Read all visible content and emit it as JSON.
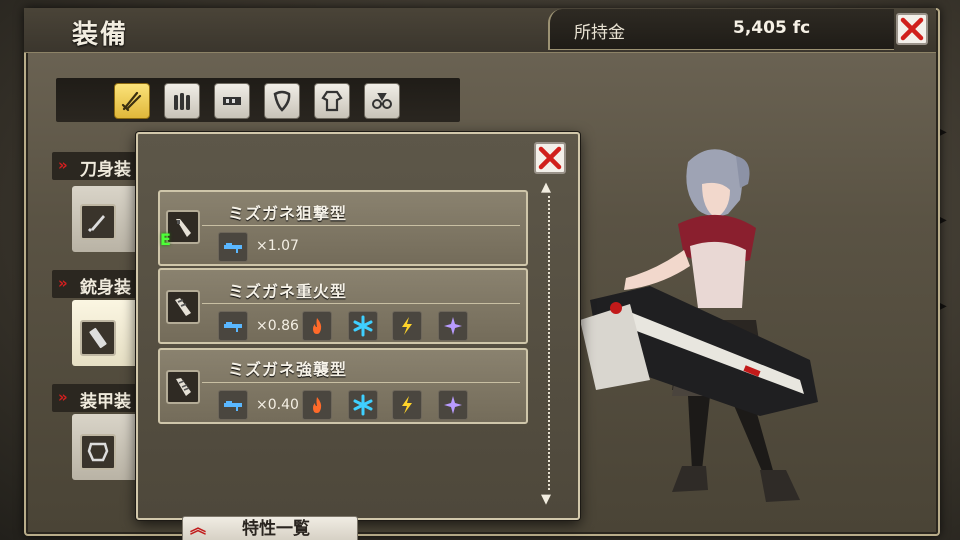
{
  "header": {
    "title": "装備",
    "money_label": "所持金",
    "money_value": "5,405 fc"
  },
  "tabs": [
    {
      "icon": "blade-icon",
      "active": true
    },
    {
      "icon": "bullets-icon",
      "active": false
    },
    {
      "icon": "gun-part-icon",
      "active": false
    },
    {
      "icon": "shield-icon",
      "active": false
    },
    {
      "icon": "clothes-icon",
      "active": false
    },
    {
      "icon": "accessory-icon",
      "active": false
    }
  ],
  "categories": [
    {
      "label": "刀身装"
    },
    {
      "label": "銃身装"
    },
    {
      "label": "装甲装"
    }
  ],
  "popup": {
    "items": [
      {
        "name": "ミズガネ狙撃型",
        "multiplier": "×1.07",
        "equipped_mark": "E",
        "elements": []
      },
      {
        "name": "ミズガネ重火型",
        "multiplier": "×0.86",
        "elements": [
          "fire-icon",
          "ice-icon",
          "thunder-icon",
          "divine-icon"
        ]
      },
      {
        "name": "ミズガネ強襲型",
        "multiplier": "×0.40",
        "elements": [
          "fire-icon",
          "ice-icon",
          "thunder-icon",
          "divine-icon"
        ]
      }
    ]
  },
  "footer": {
    "trait_tab_label": "特性一覧"
  },
  "colors": {
    "accent_red": "#d11f1f",
    "active_tab": "#f0c84a",
    "equip_green": "#4cff37"
  }
}
